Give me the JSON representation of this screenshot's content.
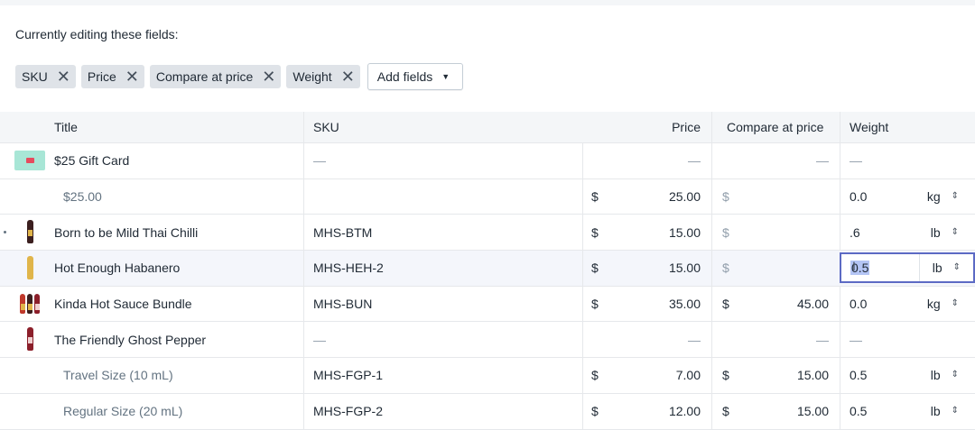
{
  "editing": {
    "label": "Currently editing these fields:",
    "chips": [
      {
        "label": "SKU"
      },
      {
        "label": "Price"
      },
      {
        "label": "Compare at price"
      },
      {
        "label": "Weight"
      }
    ],
    "add_fields_label": "Add fields"
  },
  "columns": {
    "title": "Title",
    "sku": "SKU",
    "price": "Price",
    "compare": "Compare at price",
    "weight": "Weight"
  },
  "dash": "—",
  "currency": "$",
  "rows": [
    {
      "title": "$25 Gift Card",
      "sku": "—",
      "price": "—",
      "compare": "—",
      "weight": "—",
      "unit": ""
    },
    {
      "title": "$25.00",
      "sku": "",
      "price": "25.00",
      "compare": "",
      "weight": "0.0",
      "unit": "kg"
    },
    {
      "title": "Born to be Mild Thai Chilli",
      "sku": "MHS-BTM",
      "price": "15.00",
      "compare": "",
      "weight": ".6",
      "unit": "lb"
    },
    {
      "title": "Hot Enough Habanero",
      "sku": "MHS-HEH-2",
      "price": "15.00",
      "compare": "",
      "weight": "0.5",
      "unit": "lb"
    },
    {
      "title": "Kinda Hot Sauce Bundle",
      "sku": "MHS-BUN",
      "price": "35.00",
      "compare": "45.00",
      "weight": "0.0",
      "unit": "kg"
    },
    {
      "title": "The Friendly Ghost Pepper",
      "sku": "—",
      "price": "—",
      "compare": "—",
      "weight": "—",
      "unit": ""
    },
    {
      "title": "Travel Size (10 mL)",
      "sku": "MHS-FGP-1",
      "price": "7.00",
      "compare": "15.00",
      "weight": "0.5",
      "unit": "lb"
    },
    {
      "title": "Regular Size (20 mL)",
      "sku": "MHS-FGP-2",
      "price": "12.00",
      "compare": "15.00",
      "weight": "0.5",
      "unit": "lb"
    }
  ]
}
